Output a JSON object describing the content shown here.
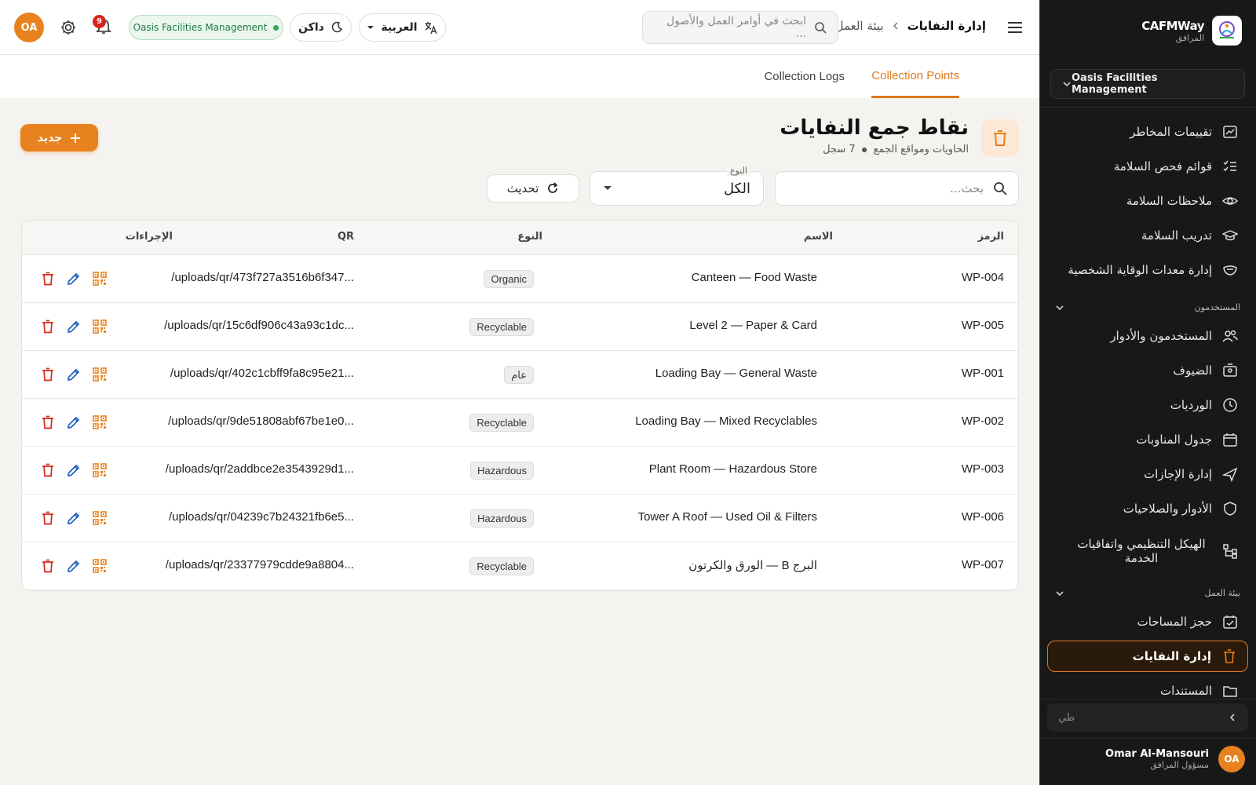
{
  "brand": {
    "name": "CAFMWay",
    "sub": "المرافق"
  },
  "org": {
    "name": "Oasis Facilities Management"
  },
  "sidebar": {
    "items": [
      {
        "label": "تقييمات المخاطر",
        "icon": "risk-chart-icon"
      },
      {
        "label": "قوائم فحص السلامة",
        "icon": "checklist-icon"
      },
      {
        "label": "ملاحظات السلامة",
        "icon": "eye-icon"
      },
      {
        "label": "تدريب السلامة",
        "icon": "graduation-cap-icon"
      },
      {
        "label": "إدارة معدات الوقاية الشخصية",
        "icon": "mask-icon"
      }
    ],
    "section_users": "المستخدمون",
    "users_items": [
      {
        "label": "المستخدمون والأدوار",
        "icon": "users-icon"
      },
      {
        "label": "الضيوف",
        "icon": "badge-icon"
      },
      {
        "label": "الورديات",
        "icon": "clock-icon"
      },
      {
        "label": "جدول المناوبات",
        "icon": "calendar-icon"
      },
      {
        "label": "إدارة الإجازات",
        "icon": "plane-icon"
      },
      {
        "label": "الأدوار والصلاحيات",
        "icon": "shield-icon"
      },
      {
        "label": "الهيكل التنظيمي واتفاقيات الخدمة",
        "icon": "org-chart-icon"
      }
    ],
    "section_workplace": "بيئة العمل",
    "workplace_items": [
      {
        "label": "حجز المساحات",
        "icon": "calendar-check-icon"
      },
      {
        "label": "إدارة النفايات",
        "icon": "trash-icon"
      },
      {
        "label": "المستندات",
        "icon": "folder-icon"
      }
    ],
    "search_placeholder": "طي",
    "user": {
      "initials": "OA",
      "name": "Omar Al-Mansouri",
      "role": "مسؤول المرافق"
    }
  },
  "header": {
    "breadcrumb_root": "بيئة العمل",
    "breadcrumb_current": "إدارة النفايات",
    "search_placeholder": "ابحث في أوامر العمل والأصول ...",
    "language": "العربية",
    "theme": "داكن",
    "org_pill": "Oasis Facilities Management",
    "notifications": "9",
    "avatar": "OA"
  },
  "tabs": [
    {
      "label": "Collection Points"
    },
    {
      "label": "Collection Logs"
    }
  ],
  "page": {
    "title": "نقاط جمع النفايات",
    "subtitle": "الحاويات ومواقع الجمع",
    "count": "7 سجل",
    "new_button": "جديد"
  },
  "filters": {
    "search_placeholder": "بحث...",
    "type_label": "النوع",
    "type_value": "الكل",
    "refresh": "تحديث"
  },
  "table": {
    "headers": {
      "code": "الرمز",
      "name": "الاسم",
      "type": "النوع",
      "qr": "QR",
      "actions": "الإجراءات"
    },
    "rows": [
      {
        "code": "WP-004",
        "name": "Canteen — Food Waste",
        "type": "Organic",
        "qr": "/uploads/qr/473f727a3516b6f347..."
      },
      {
        "code": "WP-005",
        "name": "Level 2 — Paper & Card",
        "type": "Recyclable",
        "qr": "/uploads/qr/15c6df906c43a93c1dc..."
      },
      {
        "code": "WP-001",
        "name": "Loading Bay — General Waste",
        "type": "عام",
        "qr": "/uploads/qr/402c1cbff9fa8c95e21..."
      },
      {
        "code": "WP-002",
        "name": "Loading Bay — Mixed Recyclables",
        "type": "Recyclable",
        "qr": "/uploads/qr/9de51808abf67be1e0..."
      },
      {
        "code": "WP-003",
        "name": "Plant Room — Hazardous Store",
        "type": "Hazardous",
        "qr": "/uploads/qr/2addbce2e3543929d1..."
      },
      {
        "code": "WP-006",
        "name": "Tower A Roof — Used Oil & Filters",
        "type": "Hazardous",
        "qr": "/uploads/qr/04239c7b24321fb6e5..."
      },
      {
        "code": "WP-007",
        "name": "البرج B — الورق والكرتون",
        "type": "Recyclable",
        "qr": "/uploads/qr/23377979cdde9a8804..."
      }
    ]
  },
  "colors": {
    "accent": "#e8821f",
    "sidebar_bg": "#181818",
    "delete": "#d9251c",
    "edit": "#1e5fb8"
  }
}
